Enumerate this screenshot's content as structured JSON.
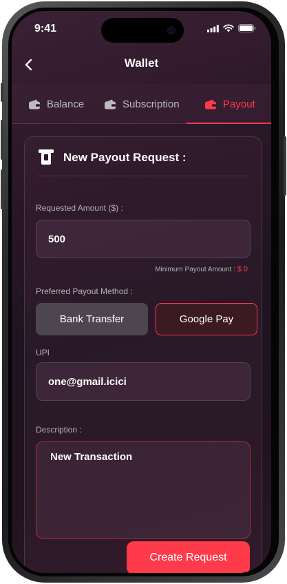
{
  "status_bar": {
    "time": "9:41"
  },
  "header": {
    "title": "Wallet",
    "back_icon": "chevron-left-icon"
  },
  "tabs": [
    {
      "label": "Balance",
      "icon": "wallet-icon",
      "active": false
    },
    {
      "label": "Subscription",
      "icon": "wallet-icon",
      "active": false
    },
    {
      "label": "Payout",
      "icon": "wallet-icon",
      "active": true
    }
  ],
  "payout_form": {
    "title": "New Payout Request :",
    "title_icon": "cash-withdraw-icon",
    "amount_label": "Requested Amount ($) :",
    "amount_value": "500",
    "min_payout_label": "Minimum Payout Amount : ",
    "min_payout_value": "$ 0",
    "method_label": "Preferred Payout Method :",
    "methods": [
      {
        "label": "Bank Transfer",
        "selected": false
      },
      {
        "label": "Google Pay",
        "selected": true
      }
    ],
    "upi_label": "UPI",
    "upi_value": "one@gmail.icici",
    "description_label": "Description :",
    "description_value": "New Transaction",
    "submit_label": "Create Request"
  },
  "colors": {
    "accent": "#ff3a4d",
    "background": "#2a1727",
    "text": "#ffffff",
    "muted_text": "#b6b2b8"
  }
}
